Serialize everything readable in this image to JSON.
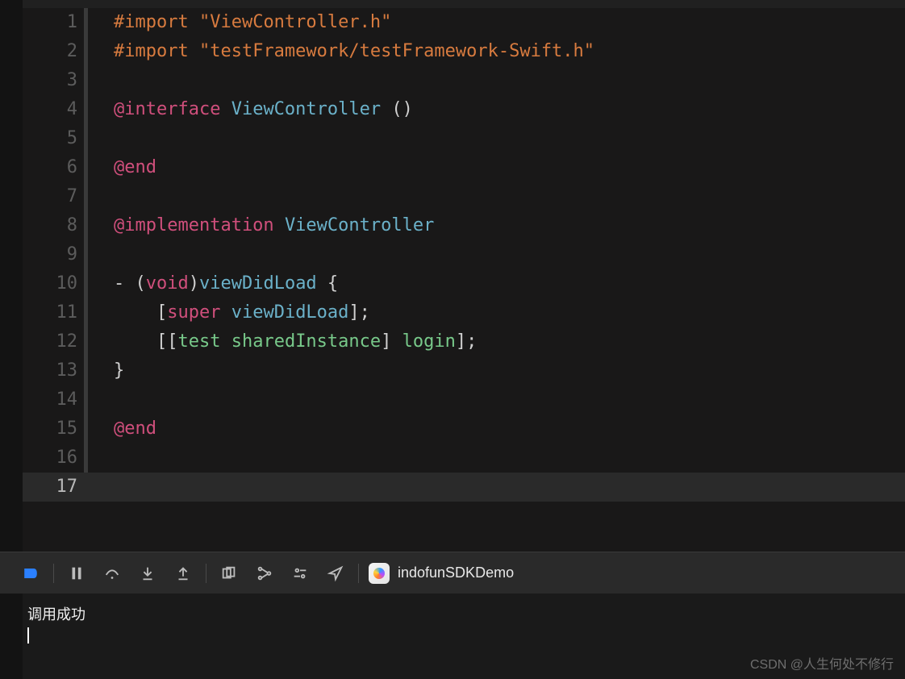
{
  "code": {
    "lines": [
      {
        "n": "1",
        "bar": true,
        "html": "<span class='t-preproc'>#import </span><span class='t-string'>\"ViewController.h\"</span>"
      },
      {
        "n": "2",
        "bar": true,
        "html": "<span class='t-preproc'>#import </span><span class='t-string'>\"testFramework/testFramework-Swift.h\"</span>"
      },
      {
        "n": "3",
        "bar": true,
        "html": ""
      },
      {
        "n": "4",
        "bar": true,
        "html": "<span class='t-keyword'>@interface</span><span class='t-plain'> </span><span class='t-type'>ViewController</span><span class='t-plain'> ()</span>"
      },
      {
        "n": "5",
        "bar": true,
        "html": ""
      },
      {
        "n": "6",
        "bar": true,
        "html": "<span class='t-keyword'>@end</span>"
      },
      {
        "n": "7",
        "bar": true,
        "html": ""
      },
      {
        "n": "8",
        "bar": true,
        "html": "<span class='t-keyword'>@implementation</span><span class='t-plain'> </span><span class='t-type'>ViewController</span>"
      },
      {
        "n": "9",
        "bar": true,
        "html": ""
      },
      {
        "n": "10",
        "bar": true,
        "html": "<span class='t-plain'>- (</span><span class='t-kw2'>void</span><span class='t-plain'>)</span><span class='t-method'>viewDidLoad</span><span class='t-plain'> {</span>"
      },
      {
        "n": "11",
        "bar": true,
        "html": "<span class='t-plain'>    [</span><span class='t-kw2'>super</span><span class='t-plain'> </span><span class='t-method'>viewDidLoad</span><span class='t-plain'>];</span>"
      },
      {
        "n": "12",
        "bar": true,
        "html": "<span class='t-plain'>    [[</span><span class='t-call'>test</span><span class='t-plain'> </span><span class='t-call'>sharedInstance</span><span class='t-plain'>] </span><span class='t-call'>login</span><span class='t-plain'>];</span>"
      },
      {
        "n": "13",
        "bar": true,
        "html": "<span class='t-plain'>}</span>"
      },
      {
        "n": "14",
        "bar": true,
        "html": ""
      },
      {
        "n": "15",
        "bar": true,
        "html": "<span class='t-keyword'>@end</span>"
      },
      {
        "n": "16",
        "bar": true,
        "html": ""
      },
      {
        "n": "17",
        "bar": false,
        "html": "",
        "current": true
      }
    ]
  },
  "toolbar": {
    "target_name": "indofunSDKDemo"
  },
  "console": {
    "output": "调用成功"
  },
  "watermark": "CSDN @人生何处不修行"
}
